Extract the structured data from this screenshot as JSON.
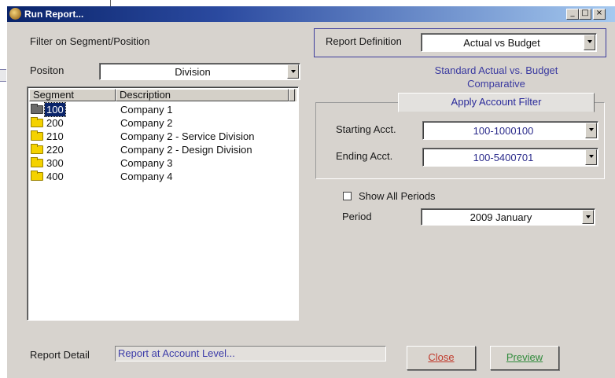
{
  "window": {
    "title": "Run Report..."
  },
  "filter": {
    "heading": "Filter on Segment/Position",
    "position_label": "Positon",
    "position_value": "Division"
  },
  "list": {
    "columns": [
      "Segment",
      "Description"
    ],
    "rows": [
      {
        "segment": "100",
        "description": "Company 1",
        "selected": true
      },
      {
        "segment": "200",
        "description": "Company 2"
      },
      {
        "segment": "210",
        "description": "Company 2 - Service Division"
      },
      {
        "segment": "220",
        "description": "Company 2 - Design Division"
      },
      {
        "segment": "300",
        "description": "Company 3"
      },
      {
        "segment": "400",
        "description": "Company 4"
      }
    ]
  },
  "report_definition": {
    "label": "Report Definition",
    "value": "Actual vs Budget",
    "description_line1": "Standard Actual vs. Budget",
    "description_line2": "Comparative"
  },
  "account_filter": {
    "tab_label": "Apply Account Filter",
    "starting_label": "Starting Acct.",
    "starting_value": "100-1000100",
    "ending_label": "Ending Acct.",
    "ending_value": "100-5400701"
  },
  "periods": {
    "show_all_label": "Show All Periods",
    "period_label": "Period",
    "period_value": "2009 January"
  },
  "report_detail": {
    "label": "Report Detail",
    "value": "Report at Account Level..."
  },
  "buttons": {
    "close": "Close",
    "preview": "Preview"
  },
  "colors": {
    "titlebar_start": "#0a246a",
    "titlebar_end": "#a6caf0",
    "accent_text": "#3a3aa0",
    "close_text": "#c0392b",
    "preview_text": "#2f8a3a"
  }
}
